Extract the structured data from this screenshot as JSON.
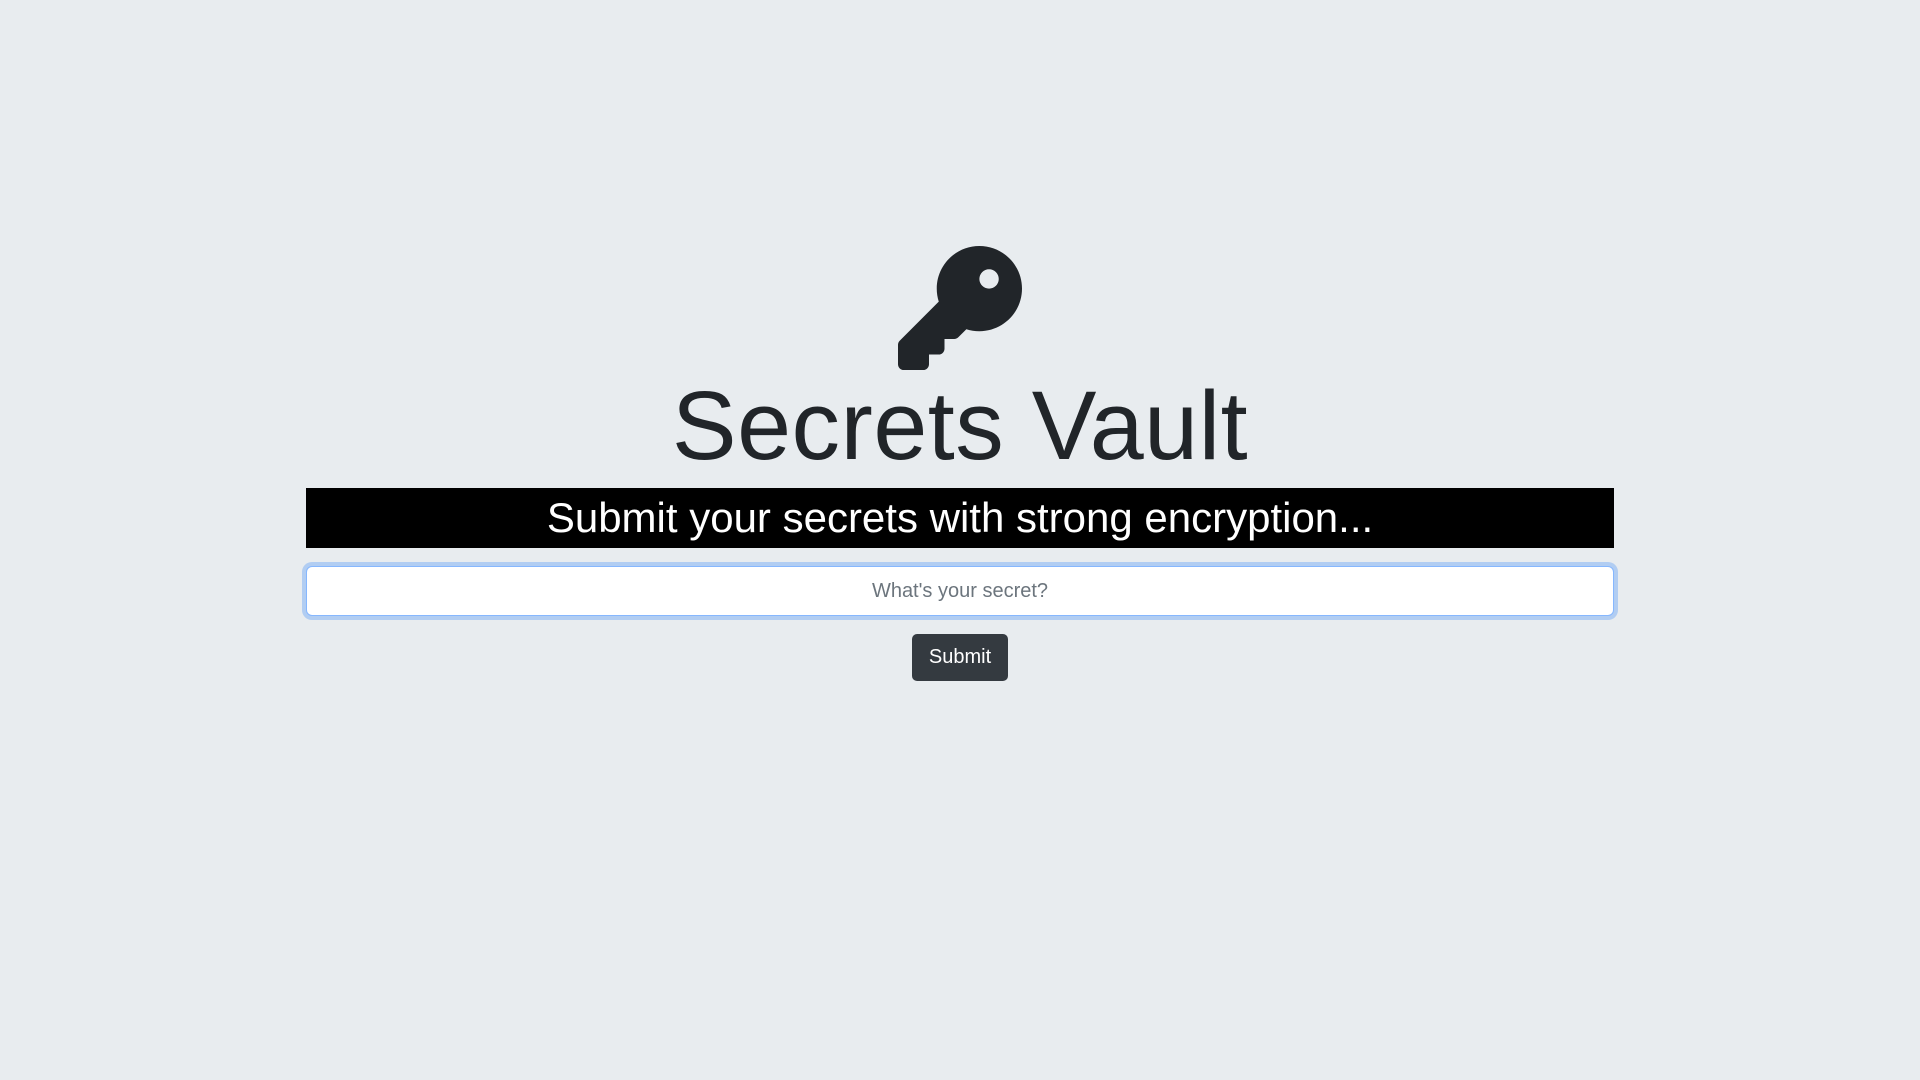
{
  "header": {
    "icon": "key-icon",
    "title": "Secrets Vault"
  },
  "banner": {
    "text": "Submit your secrets with strong encryption..."
  },
  "form": {
    "placeholder": "What's your secret?",
    "value": "",
    "submit_label": "Submit"
  },
  "colors": {
    "background": "#e8ecef",
    "banner_bg": "#000000",
    "banner_text": "#ffffff",
    "button_bg": "#343a40",
    "focus_ring": "#86b7fe"
  }
}
